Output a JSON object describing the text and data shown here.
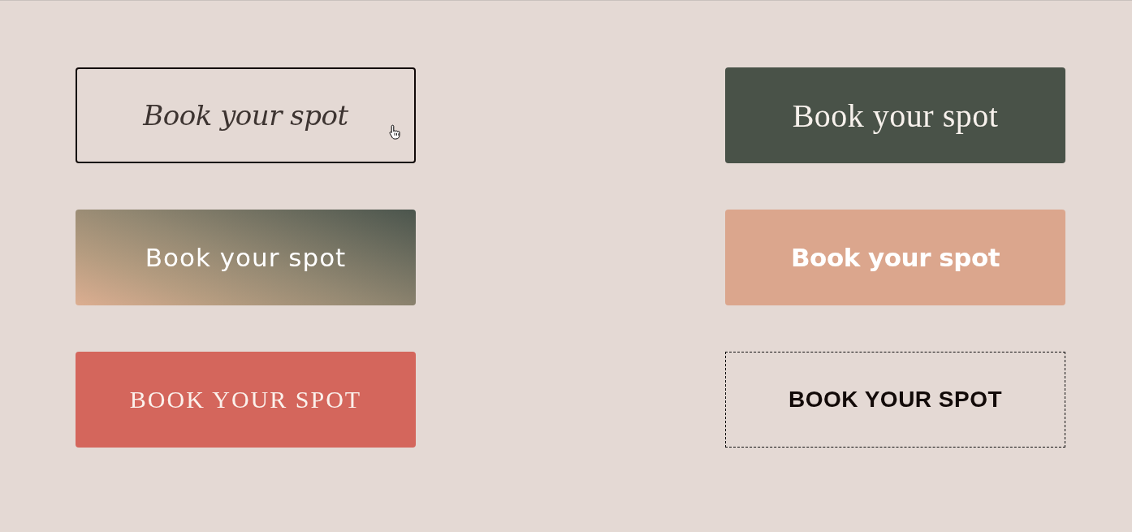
{
  "buttons": [
    {
      "label": "Book your spot",
      "kind": "script",
      "hovered": true
    },
    {
      "label": "Book your spot",
      "kind": "serif",
      "hovered": false
    },
    {
      "label": "Book your spot",
      "kind": "handwritten",
      "hovered": false
    },
    {
      "label": "Book your spot",
      "kind": "rounded",
      "hovered": false
    },
    {
      "label": "BOOK YOUR SPOT",
      "kind": "capitals",
      "hovered": false
    },
    {
      "label": "BOOK YOUR SPOT",
      "kind": "dashed",
      "hovered": false
    }
  ]
}
